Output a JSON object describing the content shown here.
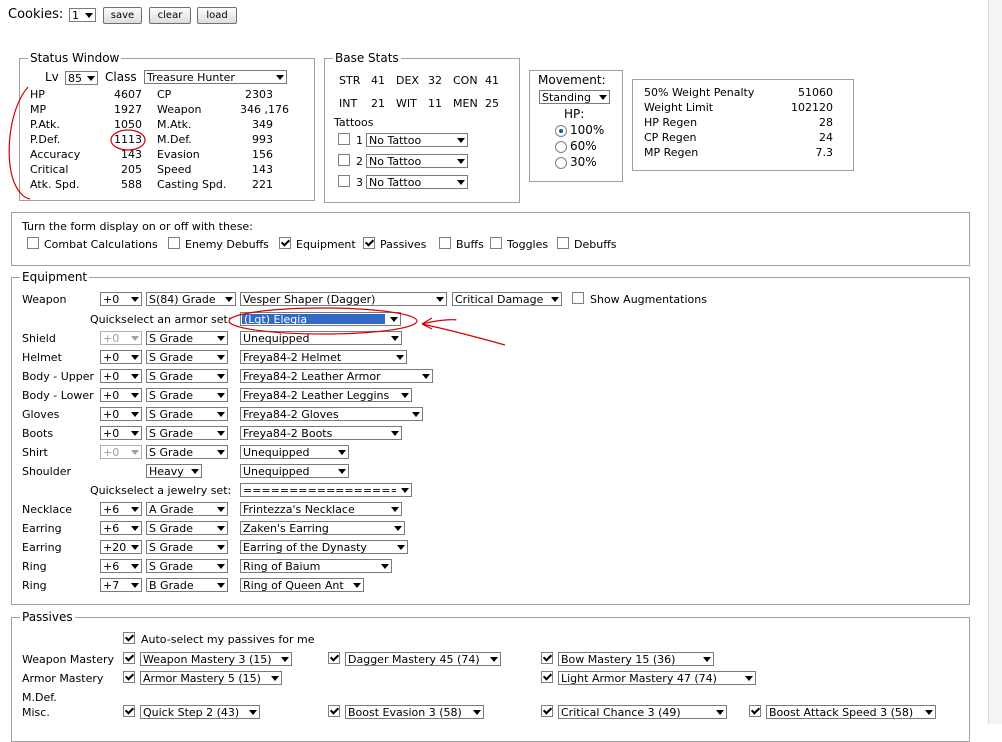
{
  "top": {
    "cookies_label": "Cookies:",
    "cookie_slot": "1",
    "save": "save",
    "clear": "clear",
    "load": "load"
  },
  "status": {
    "title": "Status Window",
    "lv_label": "Lv",
    "lv": "85",
    "class_label": "Class",
    "class_value": "Treasure Hunter",
    "left": [
      [
        "HP",
        "4607"
      ],
      [
        "MP",
        "1927"
      ],
      [
        "P.Atk.",
        "1050"
      ],
      [
        "P.Def.",
        "1113"
      ],
      [
        "Accuracy",
        "143"
      ],
      [
        "Critical",
        "205"
      ],
      [
        "Atk. Spd.",
        "588"
      ]
    ],
    "right": [
      [
        "CP",
        "2303"
      ],
      [
        "Weapon",
        "346 ,176"
      ],
      [
        "M.Atk.",
        "349"
      ],
      [
        "M.Def.",
        "993"
      ],
      [
        "Evasion",
        "156"
      ],
      [
        "Speed",
        "143"
      ],
      [
        "Casting Spd.",
        "221"
      ]
    ]
  },
  "base": {
    "title": "Base Stats",
    "row1": [
      [
        "STR",
        "41"
      ],
      [
        "DEX",
        "32"
      ],
      [
        "CON",
        "41"
      ]
    ],
    "row2": [
      [
        "INT",
        "21"
      ],
      [
        "WIT",
        "11"
      ],
      [
        "MEN",
        "25"
      ]
    ],
    "tattoos_label": "Tattoos",
    "tattoos": [
      {
        "n": "1",
        "v": "No Tattoo"
      },
      {
        "n": "2",
        "v": "No Tattoo"
      },
      {
        "n": "3",
        "v": "No Tattoo"
      }
    ]
  },
  "movement": {
    "label": "Movement:",
    "mode": "Standing",
    "hp_label": "HP:",
    "options": [
      "100%",
      "60%",
      "30%"
    ]
  },
  "weight": [
    [
      "50% Weight Penalty",
      "51060"
    ],
    [
      "Weight Limit",
      "102120"
    ],
    [
      "HP Regen",
      "28"
    ],
    [
      "CP Regen",
      "24"
    ],
    [
      "MP Regen",
      "7.3"
    ]
  ],
  "toggles": {
    "text": "Turn the form display on or off with these:",
    "items": [
      {
        "label": "Combat Calculations",
        "on": false
      },
      {
        "label": "Enemy Debuffs",
        "on": false
      },
      {
        "label": "Equipment",
        "on": true
      },
      {
        "label": "Passives",
        "on": true
      },
      {
        "label": "Buffs",
        "on": false
      },
      {
        "label": "Toggles",
        "on": false
      },
      {
        "label": "Debuffs",
        "on": false
      }
    ]
  },
  "equipment": {
    "title": "Equipment",
    "weapon": {
      "label": "Weapon",
      "enchant": "+0",
      "grade": "S(84) Grade",
      "item": "Vesper Shaper (Dagger)",
      "sa": "Critical Damage",
      "aug_label": "Show Augmentations"
    },
    "armor_qs_label": "Quickselect an armor set:",
    "armor_qs": "(Lgt) Elegia",
    "armor": [
      {
        "label": "Shield",
        "enchant": "+0",
        "grade": "S Grade",
        "item": "Unequipped"
      },
      {
        "label": "Helmet",
        "enchant": "+0",
        "grade": "S Grade",
        "item": "Freya84-2 Helmet"
      },
      {
        "label": "Body - Upper",
        "enchant": "+0",
        "grade": "S Grade",
        "item": "Freya84-2 Leather Armor"
      },
      {
        "label": "Body - Lower",
        "enchant": "+0",
        "grade": "S Grade",
        "item": "Freya84-2 Leather Leggins"
      },
      {
        "label": "Gloves",
        "enchant": "+0",
        "grade": "S Grade",
        "item": "Freya84-2 Gloves"
      },
      {
        "label": "Boots",
        "enchant": "+0",
        "grade": "S Grade",
        "item": "Freya84-2 Boots"
      },
      {
        "label": "Shirt",
        "enchant": "+0",
        "grade": "S Grade",
        "item": "Unequipped"
      },
      {
        "label": "Shoulder",
        "enchant": "",
        "grade": "Heavy",
        "item": "Unequipped"
      }
    ],
    "jewel_qs_label": "Quickselect a jewelry set:",
    "jewel_qs": "==================",
    "jewels": [
      {
        "label": "Necklace",
        "enchant": "+6",
        "grade": "A Grade",
        "item": "Frintezza's Necklace"
      },
      {
        "label": "Earring",
        "enchant": "+6",
        "grade": "S Grade",
        "item": "Zaken's Earring"
      },
      {
        "label": "Earring",
        "enchant": "+20",
        "grade": "S Grade",
        "item": "Earring of the Dynasty"
      },
      {
        "label": "Ring",
        "enchant": "+6",
        "grade": "S Grade",
        "item": "Ring of Baium"
      },
      {
        "label": "Ring",
        "enchant": "+7",
        "grade": "B Grade",
        "item": "Ring of Queen Ant"
      }
    ]
  },
  "passives": {
    "title": "Passives",
    "auto_label": "Auto-select my passives for me",
    "rows": [
      {
        "label": "Weapon Mastery",
        "items": [
          "Weapon Mastery 3 (15)",
          "Dagger Mastery 45 (74)",
          "Bow Mastery 15 (36)"
        ]
      },
      {
        "label": "Armor Mastery",
        "items": [
          "Armor Mastery 5 (15)",
          "",
          "Light Armor Mastery 47 (74)"
        ]
      },
      {
        "label": "M.Def.",
        "items": []
      },
      {
        "label": "Misc.",
        "items": [
          "Quick Step 2 (43)",
          "Boost Evasion 3 (58)",
          "Critical Chance 3 (49)",
          "Boost Attack Speed 3 (58)"
        ]
      }
    ]
  },
  "colors": {
    "annotation": "#d40000",
    "selection": "#3169c6"
  }
}
